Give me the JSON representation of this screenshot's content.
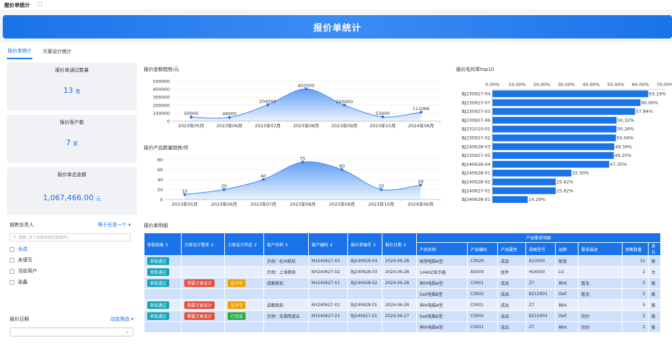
{
  "topbar": {
    "title": "报价单统计",
    "expand_icon": "⛶"
  },
  "banner": {
    "title": "报价单统计"
  },
  "tabs": [
    {
      "label": "报价单统计",
      "active": true
    },
    {
      "label": "方案设计统计",
      "active": false
    }
  ],
  "cards": [
    {
      "title": "报价单通过数量",
      "value": "13",
      "unit": "笔"
    },
    {
      "title": "报价客户数",
      "value": "7",
      "unit": "家"
    },
    {
      "title": "报价单总金额",
      "value": "1,067,466.00",
      "unit": "元"
    }
  ],
  "filters": {
    "salesperson": {
      "label": "销售负责人",
      "mode": "等于任意一个",
      "placeholder": "搜索 (多个关键词用空格隔开)",
      "options": [
        "全选",
        "未填写",
        "当前用户",
        "张鑫"
      ]
    },
    "date": {
      "label": "报价日期",
      "mode": "动态筛选"
    }
  },
  "chart_data": [
    {
      "type": "line",
      "title": "报价金额趋势/元",
      "categories": [
        "2023年05月",
        "2023年06月",
        "2023年07月",
        "2023年08月",
        "2023年09月",
        "2023年10月",
        "2024年06月"
      ],
      "values": [
        50000,
        46000,
        204000,
        402500,
        200000,
        53000,
        111066
      ],
      "data_labels": [
        "50000",
        "46000",
        "204000",
        "402500",
        "200000",
        "53000",
        "111066"
      ],
      "yticks": [
        "0",
        "100000",
        "200000",
        "300000",
        "400000",
        "500000"
      ],
      "ylim": [
        0,
        500000
      ]
    },
    {
      "type": "line",
      "title": "报价产品数量趋势/件",
      "categories": [
        "2023年05月",
        "2023年06月",
        "2023年07月",
        "2023年08月",
        "2023年09月",
        "2023年10月",
        "2024年06月"
      ],
      "values": [
        10,
        20,
        40,
        75,
        60,
        20,
        29
      ],
      "data_labels": [
        "10",
        "20",
        "40",
        "75",
        "60",
        "20",
        "29"
      ],
      "yticks": [
        "0",
        "20",
        "40",
        "60",
        "80"
      ],
      "ylim": [
        0,
        80
      ]
    },
    {
      "type": "bar",
      "title": "报价毛利率top10",
      "orientation": "horizontal",
      "xticks": [
        "0.00%",
        "10.00%",
        "20.00%",
        "30.00%",
        "40.00%",
        "50.00%",
        "60.00%",
        "70.00%"
      ],
      "xlim": [
        0,
        70
      ],
      "categories": [
        "BJ230927-04",
        "BJ230927-07",
        "BJ230927-03",
        "BJ230927-06",
        "BJ231010-01",
        "BJ230927-02",
        "BJ240628-03",
        "BJ230927-05",
        "BJ240628-04",
        "BJ240628-01",
        "BJ240628-02",
        "BJ240627-01",
        "BJ240628-01"
      ],
      "values": [
        63.16,
        60.0,
        57.84,
        50.32,
        50.26,
        50.04,
        49.39,
        49.2,
        47.35,
        32.0,
        25.62,
        25.62,
        14.29
      ],
      "data_labels": [
        "63.16%",
        "60.00%",
        "57.84%",
        "50.32%",
        "50.26%",
        "50.04%",
        "49.39%",
        "49.20%",
        "47.35%",
        "32.00%",
        "25.62%",
        "25.62%",
        "14.29%"
      ],
      "color": "#1a73e8"
    }
  ],
  "detail": {
    "title": "报价单明细",
    "group_header": "产品需求明细",
    "headers": [
      "审批结果",
      "方案设计需求",
      "方案设计状态",
      "客户名称",
      "客户编码",
      "报价单编号",
      "报价日期",
      "产品名称",
      "产品编码",
      "产品属性",
      "规格型号",
      "品牌",
      "需求描述",
      "销售数量",
      "单位"
    ],
    "rows": [
      {
        "cls": "g1",
        "result": "审批通过",
        "need": "",
        "status": "",
        "status_color": "",
        "customer": "示例：杭州帆软",
        "ccode": "KH240627-03",
        "no": "BJ240628-04",
        "date": "2024-06-28",
        "pname": "联想电脑A型",
        "pcode": "C0020",
        "attr": "成品",
        "spec": "A13000",
        "brand": "联想",
        "desc": "",
        "qty": "12",
        "unit": "套"
      },
      {
        "cls": "g2",
        "result": "审批通过",
        "need": "",
        "status": "",
        "status_color": "",
        "customer": "示例：上海帆软",
        "ccode": "KH240627-02",
        "no": "BJ240628-03",
        "date": "2024-06-28",
        "pname": "144HZ显示器",
        "pcode": "A0009",
        "attr": "组件",
        "spec": "HL6000",
        "brand": "LG",
        "desc": "",
        "qty": "2",
        "unit": "台"
      },
      {
        "cls": "g1",
        "result": "审批通过",
        "need": "需要方案设计",
        "status": "设计中",
        "status_color": "orange",
        "customer": "成都帆软",
        "ccode": "KH240627-01",
        "no": "BJ240628-02",
        "date": "2024-06-28",
        "pname": "神州电脑A型",
        "pcode": "C0001",
        "attr": "成品",
        "spec": "Z7",
        "brand": "神州",
        "desc": "暂无",
        "qty": "3",
        "unit": "套"
      },
      {
        "cls": "g1",
        "result": "",
        "need": "",
        "status": "",
        "status_color": "",
        "customer": "",
        "ccode": "",
        "no": "",
        "date": "",
        "pname": "Dell电脑B型",
        "pcode": "C0002",
        "attr": "成品",
        "spec": "B210001",
        "brand": "Dell",
        "desc": "暂无",
        "qty": "3",
        "unit": "套"
      },
      {
        "cls": "g2",
        "result": "审批通过",
        "need": "需要方案设计",
        "status": "设计中",
        "status_color": "orange",
        "customer": "成都帆软",
        "ccode": "KH240627-01",
        "no": "BJ240628-01",
        "date": "2024-06-28",
        "pname": "神州电脑A型",
        "pcode": "C0001",
        "attr": "成品",
        "spec": "Z7",
        "brand": "神州",
        "desc": "",
        "qty": "5",
        "unit": "套"
      },
      {
        "cls": "g1",
        "result": "审批通过",
        "need": "需要方案设计",
        "status": "已完成",
        "status_color": "green",
        "customer": "示例：无锡简道云",
        "ccode": "KH240627-01",
        "no": "BJ240627-01",
        "date": "2024-06-27",
        "pname": "Dell电脑B型",
        "pcode": "C0002",
        "attr": "成品",
        "spec": "B210001",
        "brand": "Dell",
        "desc": "完好",
        "qty": "2",
        "unit": "套"
      },
      {
        "cls": "g1",
        "result": "",
        "need": "",
        "status": "",
        "status_color": "",
        "customer": "",
        "ccode": "",
        "no": "",
        "date": "",
        "pname": "神州电脑A型",
        "pcode": "C0001",
        "attr": "成品",
        "spec": "Z7",
        "brand": "神州",
        "desc": "完好",
        "qty": "2",
        "unit": "套"
      }
    ]
  },
  "colors": {
    "accent": "#1a73e8",
    "chart_fill": "#5b9bf5"
  }
}
